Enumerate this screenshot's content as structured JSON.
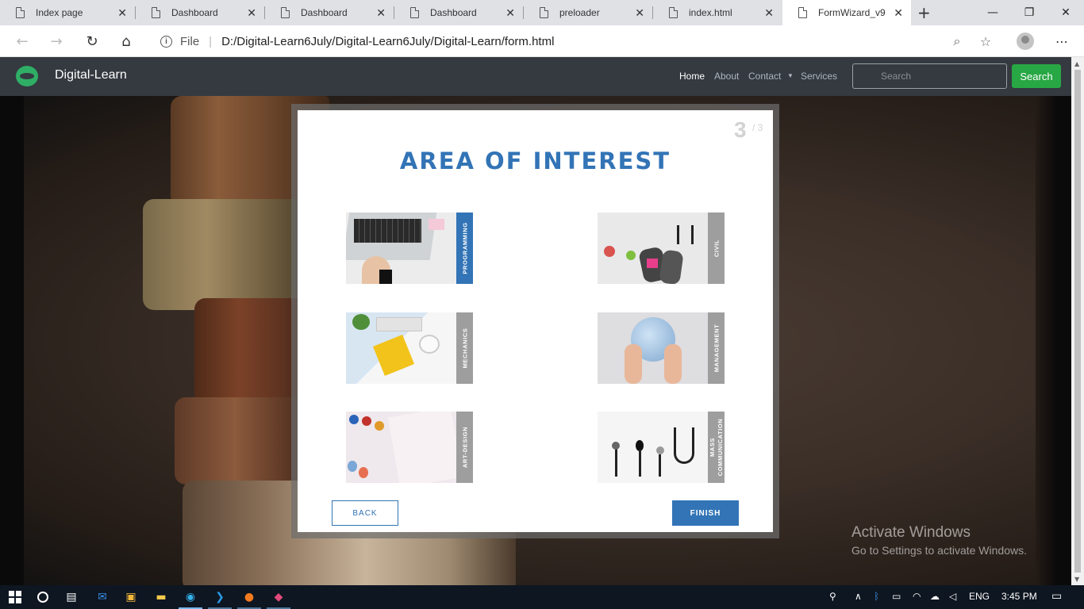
{
  "browser": {
    "tabs": [
      {
        "label": "Index page"
      },
      {
        "label": "Dashboard"
      },
      {
        "label": "Dashboard"
      },
      {
        "label": "Dashboard"
      },
      {
        "label": "preloader"
      },
      {
        "label": "index.html"
      },
      {
        "label": "FormWizard_v9"
      }
    ],
    "address_prefix": "File",
    "url": "D:/Digital-Learn6July/Digital-Learn6July/Digital-Learn/form.html"
  },
  "site": {
    "brand": "Digital-Learn",
    "menu": [
      "Home",
      "About",
      "Contact",
      "Services"
    ],
    "search_placeholder": "Search",
    "search_button": "Search"
  },
  "wizard": {
    "step": "3",
    "step_total": "/ 3",
    "title": "AREA OF INTEREST",
    "options": [
      {
        "label": "PROGRAMMING",
        "selected": true
      },
      {
        "label": "CIVIL",
        "selected": false
      },
      {
        "label": "MECHANICS",
        "selected": false
      },
      {
        "label": "MANAGEMENT",
        "selected": false
      },
      {
        "label": "ART-DESIGN",
        "selected": false
      },
      {
        "label": "MASS COMMUNICATION",
        "selected": false
      }
    ],
    "back_label": "BACK",
    "finish_label": "FINISH"
  },
  "watermark": {
    "line1": "Activate Windows",
    "line2": "Go to Settings to activate Windows."
  },
  "taskbar": {
    "language": "ENG",
    "time": "3:45 PM"
  },
  "colors": {
    "accent": "#3274b6",
    "nav_bg": "#343a40",
    "search_green": "#28a745"
  }
}
